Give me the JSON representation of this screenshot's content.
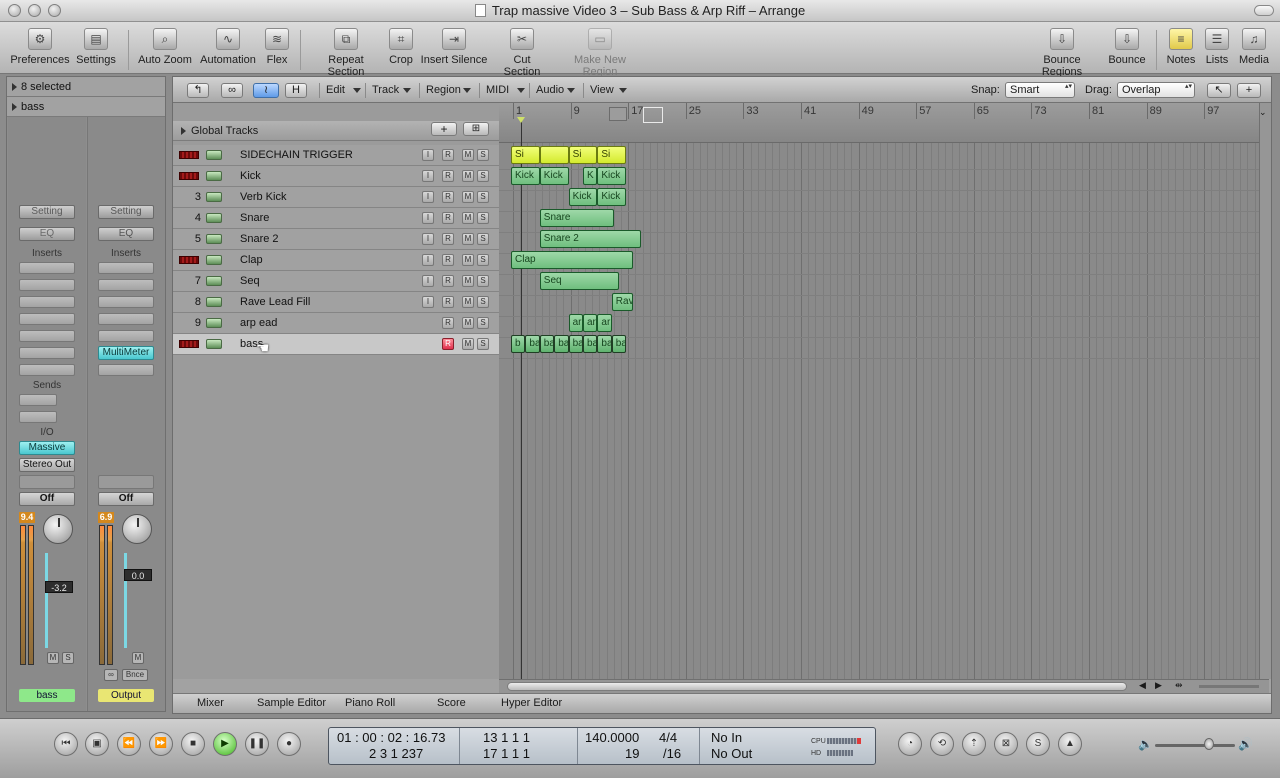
{
  "window": {
    "title": "Trap massive Video 3 – Sub Bass & Arp Riff – Arrange"
  },
  "toolbar": {
    "preferences": "Preferences",
    "settings": "Settings",
    "auto_zoom": "Auto Zoom",
    "automation": "Automation",
    "flex": "Flex",
    "repeat_section": "Repeat Section",
    "crop": "Crop",
    "insert_silence": "Insert Silence",
    "cut_section": "Cut Section",
    "make_new_region": "Make New Region",
    "bounce_regions": "Bounce Regions",
    "bounce": "Bounce",
    "notes": "Notes",
    "lists": "Lists",
    "media": "Media"
  },
  "inspector": {
    "selection": "8 selected",
    "track_name": "bass",
    "left": {
      "setting": "Setting",
      "eq": "EQ",
      "inserts": "Inserts",
      "sends": "Sends",
      "io": "I/O",
      "input": "Massive",
      "output": "Stereo Out",
      "automation": "Off",
      "meter_peak": "9.4",
      "volume": "-3.2",
      "mute": "M",
      "solo": "S",
      "name": "bass"
    },
    "right": {
      "setting": "Setting",
      "eq": "EQ",
      "inserts": "Inserts",
      "insert1": "MultiMeter",
      "automation": "Off",
      "meter_peak": "6.9",
      "volume": "0.0",
      "mute": "M",
      "link": "∞",
      "bounce": "Bnce",
      "name": "Output"
    }
  },
  "local_menu": {
    "edit": "Edit",
    "track": "Track",
    "region": "Region",
    "midi": "MIDI",
    "audio": "Audio",
    "view": "View",
    "snap_label": "Snap:",
    "snap_value": "Smart",
    "drag_label": "Drag:",
    "drag_value": "Overlap",
    "h_btn": "H"
  },
  "global_tracks": "Global Tracks",
  "tracks": [
    {
      "num": "",
      "name": "SIDECHAIN TRIGGER",
      "muted": true,
      "i": "I",
      "r": "R",
      "m": "M",
      "s": "S"
    },
    {
      "num": "",
      "name": "Kick",
      "muted": true,
      "i": "I",
      "r": "R",
      "m": "M",
      "s": "S"
    },
    {
      "num": "3",
      "name": "Verb Kick",
      "muted": false,
      "i": "I",
      "r": "R",
      "m": "M",
      "s": "S"
    },
    {
      "num": "4",
      "name": "Snare",
      "muted": false,
      "i": "I",
      "r": "R",
      "m": "M",
      "s": "S"
    },
    {
      "num": "5",
      "name": "Snare 2",
      "muted": false,
      "i": "I",
      "r": "R",
      "m": "M",
      "s": "S"
    },
    {
      "num": "",
      "name": "Clap",
      "muted": true,
      "i": "I",
      "r": "R",
      "m": "M",
      "s": "S"
    },
    {
      "num": "7",
      "name": "Seq",
      "muted": false,
      "i": "I",
      "r": "R",
      "m": "M",
      "s": "S"
    },
    {
      "num": "8",
      "name": "Rave Lead Fill",
      "muted": false,
      "i": "I",
      "r": "R",
      "m": "M",
      "s": "S"
    },
    {
      "num": "9",
      "name": "arp ead",
      "muted": false,
      "i": "",
      "r": "R",
      "m": "M",
      "s": "S"
    },
    {
      "num": "",
      "name": "bass",
      "muted": true,
      "i": "",
      "r": "R",
      "m": "M",
      "s": "S"
    }
  ],
  "ruler": [
    "1",
    "9",
    "17",
    "25",
    "33",
    "41",
    "49",
    "57",
    "65",
    "73",
    "81",
    "89",
    "97"
  ],
  "regions": {
    "sidechain": [
      "Si",
      "",
      "Si",
      "Si"
    ],
    "kick": [
      "Kick",
      "Kick",
      "K",
      "Kick"
    ],
    "verb_kick": [
      "Kick",
      "Kick"
    ],
    "snare": "Snare",
    "snare2": "Snare 2",
    "clap": "Clap",
    "seq": "Seq",
    "rave": "Rav",
    "arp": [
      "ar",
      "ar",
      "ar"
    ],
    "bass": [
      "b",
      "ba",
      "ba",
      "ba",
      "ba",
      "ba",
      "ba",
      "ba"
    ]
  },
  "editors": {
    "mixer": "Mixer",
    "sample_editor": "Sample Editor",
    "piano_roll": "Piano Roll",
    "score": "Score",
    "hyper_editor": "Hyper Editor"
  },
  "transport": {
    "smpte": "01 : 00 : 02 : 16.73",
    "bars": "2   3   1  237",
    "left_locator": "13    1    1      1",
    "right_locator": "17    1    1      1",
    "tempo": "140.0000",
    "division_small": "19",
    "signature": "4/4",
    "division": "/16",
    "midi_in": "No In",
    "midi_out": "No Out",
    "cpu_label": "CPU",
    "hd_label": "HD"
  }
}
